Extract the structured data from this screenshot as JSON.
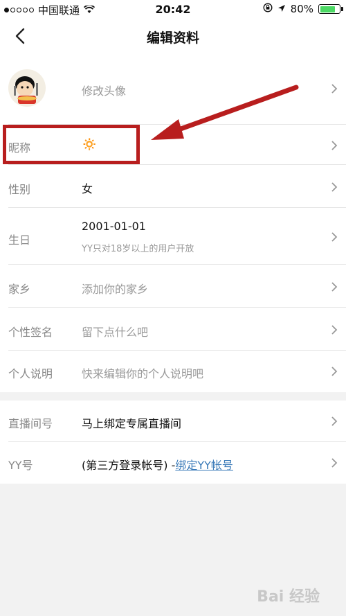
{
  "status_bar": {
    "carrier": "中国联通",
    "time": "20:42",
    "battery_percent": "80%",
    "battery_level": 0.8,
    "signal_bars_filled": 1
  },
  "nav": {
    "title": "编辑资料"
  },
  "profile": {
    "avatar_label": "修改头像",
    "fields": [
      {
        "label": "昵称",
        "value": "🔅"
      },
      {
        "label": "性别",
        "value": "女"
      },
      {
        "label": "生日",
        "value": "2001-01-01",
        "hint": "YY只对18岁以上的用户开放"
      },
      {
        "label": "家乡",
        "value": "添加你的家乡"
      },
      {
        "label": "个性签名",
        "value": "留下点什么吧"
      },
      {
        "label": "个人说明",
        "value": "快来编辑你的个人说明吧"
      }
    ]
  },
  "account": {
    "fields": [
      {
        "label": "直播间号",
        "value": "马上绑定专属直播间"
      },
      {
        "label": "YY号",
        "value": "(第三方登录帐号) -",
        "link": "绑定YY帐号"
      }
    ]
  },
  "annotation": {
    "color": "#b81e1e"
  },
  "watermark": {
    "text": "Bai 经验"
  }
}
